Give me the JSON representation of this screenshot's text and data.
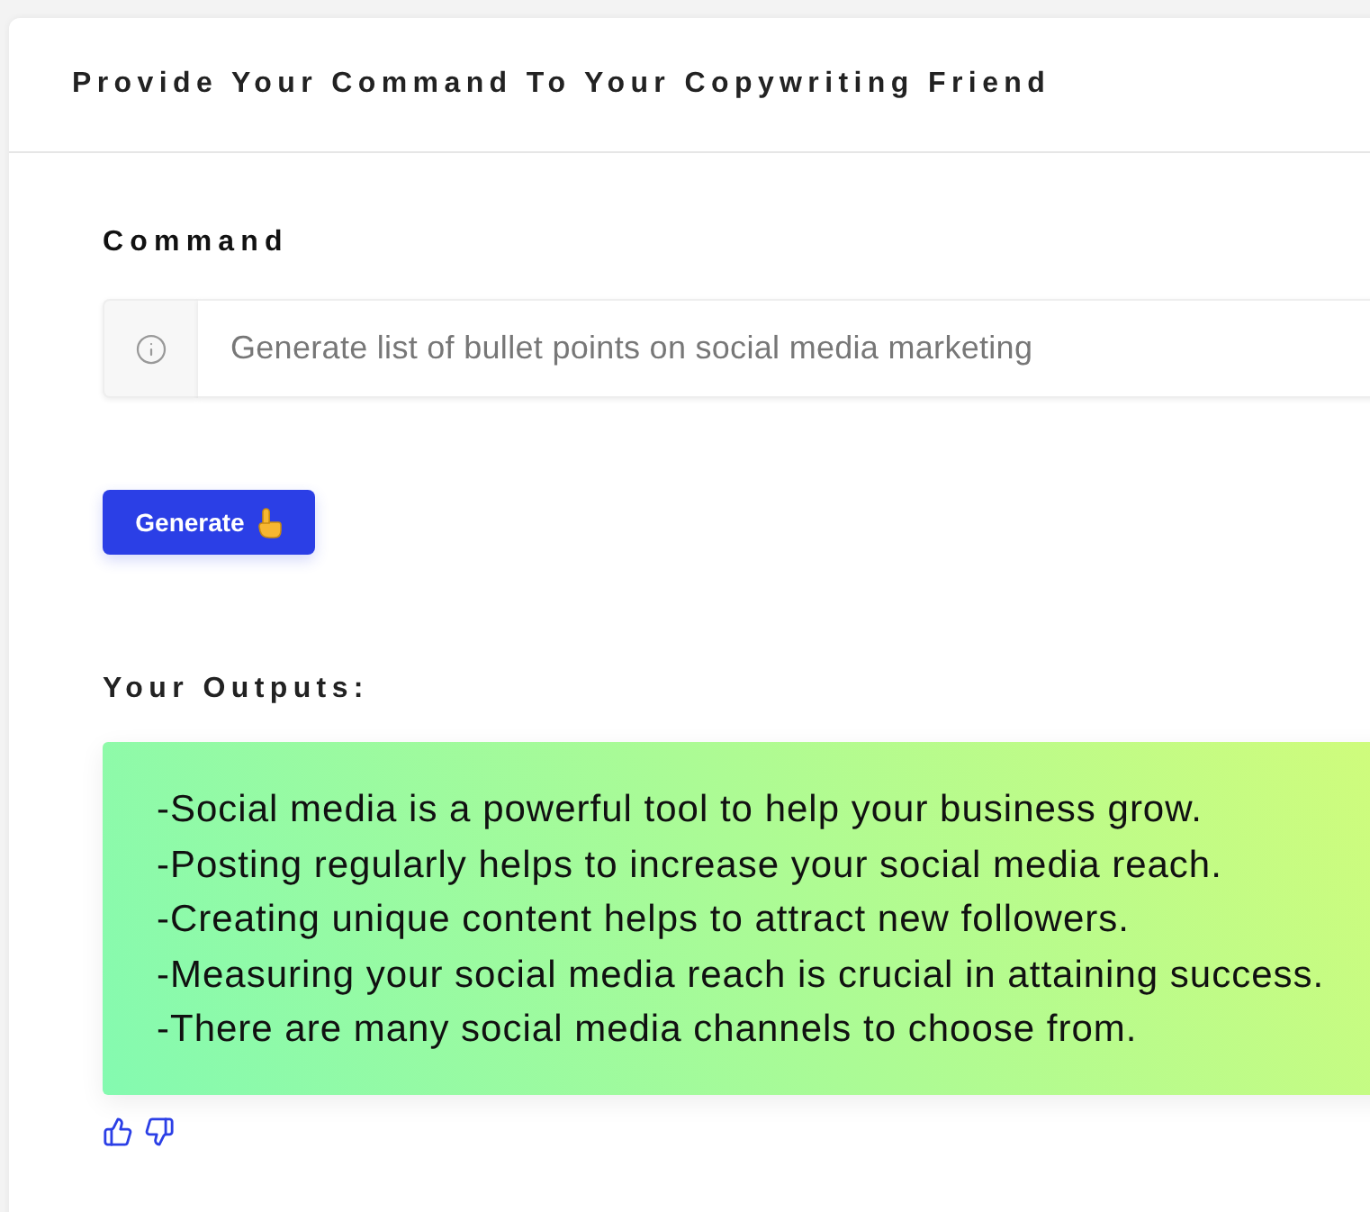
{
  "card": {
    "title": "Provide Your Command To Your Copywriting Friend"
  },
  "command": {
    "label": "Command",
    "value": "Generate list of bullet points on social media marketing"
  },
  "generate_button": {
    "label": "Generate"
  },
  "outputs": {
    "label": "Your Outputs:",
    "lines": [
      "-Social media is a powerful tool to help your business grow.",
      "-Posting regularly helps to increase your social media reach.",
      "-Creating unique content helps to attract new followers.",
      "-Measuring your social media reach is crucial in attaining success.",
      "-There are many social media channels to choose from."
    ]
  }
}
